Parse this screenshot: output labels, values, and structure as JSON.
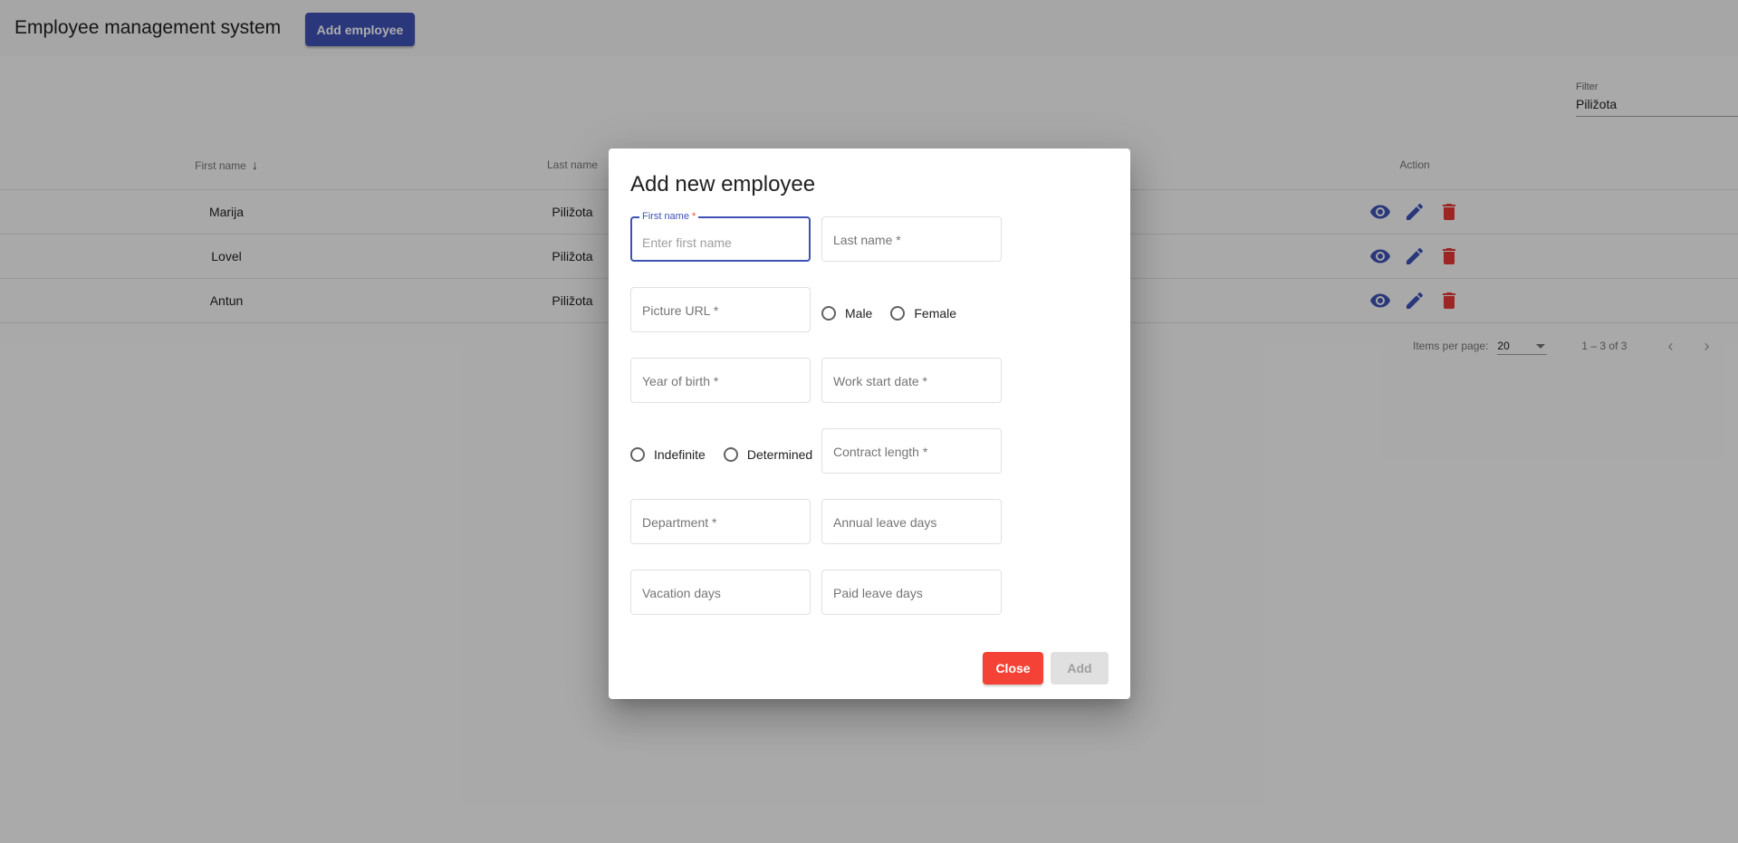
{
  "app": {
    "title": "Employee management system",
    "add_button": "Add employee"
  },
  "filter": {
    "label": "Filter",
    "value": "Piližota"
  },
  "table": {
    "columns": [
      "First name",
      "Last name",
      "Action"
    ],
    "rows": [
      {
        "first": "Marija",
        "last": "Piližota"
      },
      {
        "first": "Lovel",
        "last": "Piližota"
      },
      {
        "first": "Antun",
        "last": "Piližota"
      }
    ]
  },
  "paginator": {
    "items_per_page_label": "Items per page:",
    "items_per_page": "20",
    "range": "1 – 3 of 3"
  },
  "dialog": {
    "title": "Add new employee",
    "first_name_label": "First name",
    "required_mark": "*",
    "first_name_placeholder": "Enter first name",
    "last_name_placeholder": "Last name *",
    "picture_url_placeholder": "Picture URL *",
    "gender_male": "Male",
    "gender_female": "Female",
    "year_of_birth_placeholder": "Year of birth *",
    "work_start_placeholder": "Work start date *",
    "contract_indefinite": "Indefinite",
    "contract_determined": "Determined",
    "contract_length_placeholder": "Contract length *",
    "department_placeholder": "Department *",
    "annual_leave_placeholder": "Annual leave days",
    "vacation_placeholder": "Vacation days",
    "paid_leave_placeholder": "Paid leave days",
    "close_label": "Close",
    "add_label": "Add"
  },
  "colors": {
    "primary": "#3f51b5",
    "warn": "#f44336",
    "overlay": "rgba(0,0,0,0.32)"
  },
  "icons": {
    "view": "eye-icon",
    "edit": "pencil-icon",
    "delete": "trash-icon",
    "sort": "arrow-down-icon",
    "prev": "chevron-left-icon",
    "next": "chevron-right-icon"
  }
}
